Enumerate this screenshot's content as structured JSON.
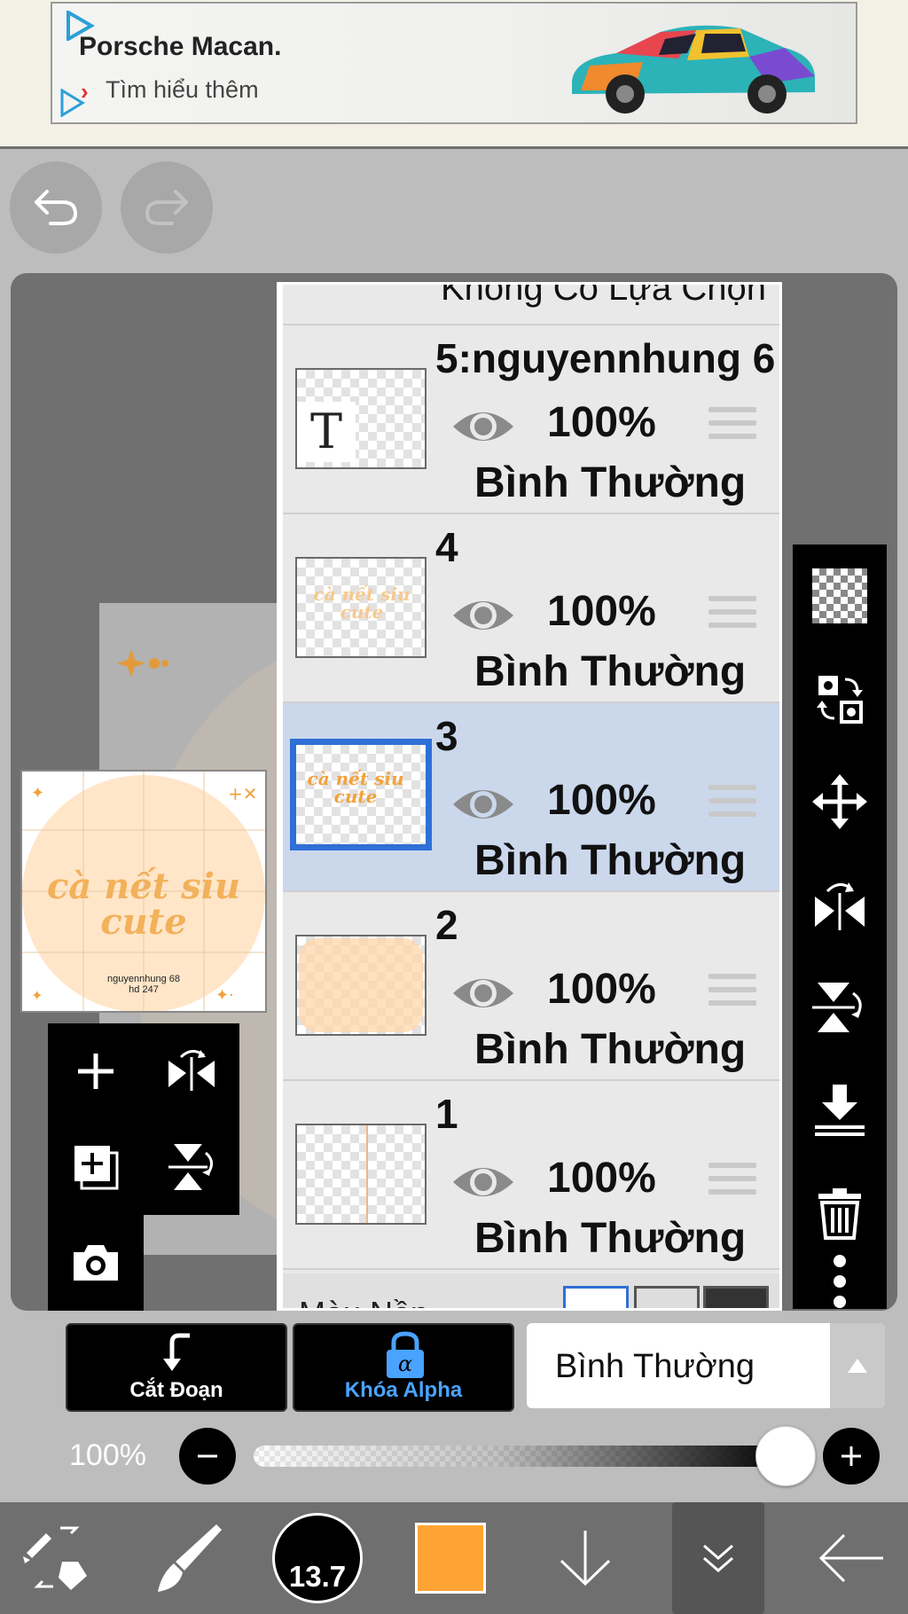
{
  "ad": {
    "title": "Porsche Macan.",
    "link": "Tìm hiểu thêm"
  },
  "layers_panel": {
    "header_partial": "Không Có Lựa Chọn",
    "layers": [
      {
        "name": "5:nguyennhung 6",
        "opacity": "100%",
        "blend": "Bình Thường",
        "thumb": "text",
        "selected": false
      },
      {
        "name": "4",
        "opacity": "100%",
        "blend": "Bình Thường",
        "thumb": "lettering",
        "selected": false
      },
      {
        "name": "3",
        "opacity": "100%",
        "blend": "Bình Thường",
        "thumb": "lettering",
        "selected": true
      },
      {
        "name": "2",
        "opacity": "100%",
        "blend": "Bình Thường",
        "thumb": "peach",
        "selected": false
      },
      {
        "name": "1",
        "opacity": "100%",
        "blend": "Bình Thường",
        "thumb": "lines",
        "selected": false
      }
    ],
    "footer_partial": "Màu Nền"
  },
  "preview": {
    "lettering": "cà nết siu cute",
    "credit_line1": "nguyennhung 68",
    "credit_line2": "hd 247"
  },
  "thumb_text_glyph": "T",
  "thumb_lettering": "cà nết siu cute",
  "controls": {
    "clipping_label": "Cắt Đoạn",
    "alpha_lock_label": "Khóa Alpha",
    "blend_mode": "Bình Thường"
  },
  "opacity": {
    "label": "100%",
    "value_fraction": 1.0
  },
  "bottom_bar": {
    "brush_size": "13.7"
  },
  "colors": {
    "primary_color": "#ffa433",
    "selection_blue": "#2f6fd6",
    "alpha_lock_blue": "#4aa3ff",
    "selected_row": "#cbd8ec"
  }
}
